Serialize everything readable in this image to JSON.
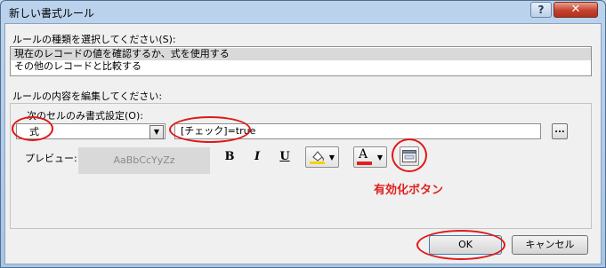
{
  "window": {
    "title": "新しい書式ルール",
    "help_label": "?",
    "close_label": "✕"
  },
  "rule_type": {
    "label": "ルールの種類を選択してください(S):",
    "items": [
      "現在のレコードの値を確認するか、式を使用する",
      "その他のレコードと比較する"
    ],
    "selected_index": 0
  },
  "rule_edit": {
    "label": "ルールの内容を編集してください:",
    "condition_label": "次のセルのみ書式設定(O):",
    "condition_value": "式",
    "expression": "[チェック]=true",
    "ellipsis_label": "...",
    "preview_label": "プレビュー:",
    "preview_text": "AaBbCcYyZz",
    "bold_label": "B",
    "italic_label": "I",
    "underline_label": "U",
    "fill_color": "#f2d400",
    "font_color": "#e02020",
    "font_color_glyph": "A"
  },
  "annotation": {
    "text": "有効化ボタン",
    "color": "#e02020"
  },
  "buttons": {
    "ok_label": "OK",
    "cancel_label": "キャンセル"
  },
  "icons": [
    "help-icon",
    "close-icon",
    "dropdown-arrow-icon",
    "ellipsis-icon",
    "bold-icon",
    "italic-icon",
    "underline-icon",
    "fill-color-icon",
    "font-color-icon",
    "enable-toggle-icon"
  ]
}
